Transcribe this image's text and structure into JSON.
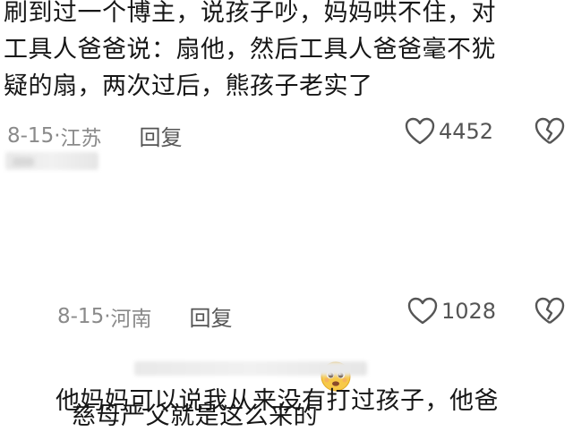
{
  "comments": [
    {
      "text": "刷到过一个博主，说孩子吵，妈妈哄不住，对\n工具人爸爸说：扇他，然后工具人爸爸毫不犹\n疑的扇，两次过后，熊孩子老实了",
      "date": "8-15",
      "region": "江苏",
      "reply_label": "回复",
      "likes": "4452"
    },
    {
      "text": "慈母严父就是这么来的",
      "date": "8-15",
      "region": "河南",
      "reply_label": "回复",
      "likes": "1028"
    },
    {
      "text": "他妈妈可以说我从来没有打过孩子，他爸"
    }
  ],
  "icons": {
    "like": "heart-outline-icon",
    "dislike": "broken-heart-icon",
    "emoji": "pleading-face-emoji-icon"
  },
  "colors": {
    "text": "#161616",
    "meta": "#8a8a8a",
    "icon": "#555555"
  }
}
